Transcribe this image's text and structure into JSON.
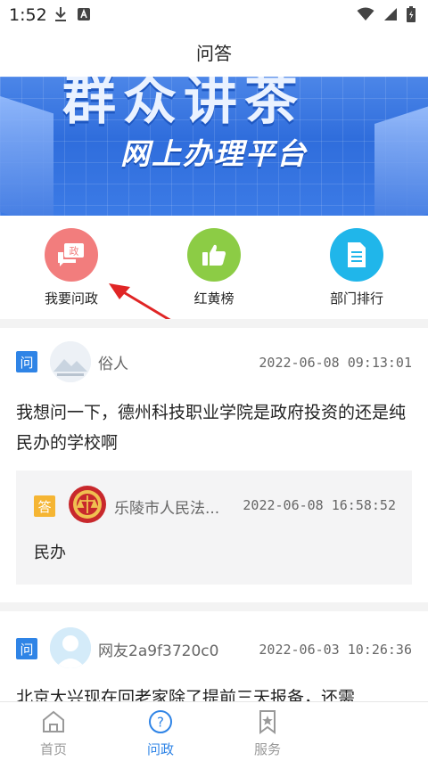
{
  "status": {
    "time": "1:52"
  },
  "nav": {
    "title": "问答"
  },
  "banner": {
    "title_partial": "群众讲茶",
    "subtitle": "网上办理平台"
  },
  "quick_actions": [
    {
      "label": "我要问政",
      "icon": "ask-government-icon",
      "color": "#f27d7d"
    },
    {
      "label": "红黄榜",
      "icon": "thumbs-up-icon",
      "color": "#8ccc45"
    },
    {
      "label": "部门排行",
      "icon": "document-icon",
      "color": "#20b6ea"
    }
  ],
  "posts": [
    {
      "badge": "问",
      "author": "俗人",
      "date": "2022-06-08 09:13:01",
      "question": "我想问一下，德州科技职业学院是政府投资的还是纯民办的学校啊",
      "answer": {
        "badge": "答",
        "author": "乐陵市人民法...",
        "date": "2022-06-08 16:58:52",
        "text": "民办"
      }
    },
    {
      "badge": "问",
      "author": "网友2a9f3720c0",
      "date": "2022-06-03 10:26:36",
      "question": "北京大兴现在回老家除了提前三天报备，还需"
    }
  ],
  "tabs": [
    {
      "label": "首页",
      "icon": "home-icon",
      "active": false
    },
    {
      "label": "问政",
      "icon": "question-icon",
      "active": true
    },
    {
      "label": "服务",
      "icon": "star-bookmark-icon",
      "active": false
    }
  ],
  "colors": {
    "accent": "#2f84e6",
    "inactive": "#999999",
    "answer_badge": "#f5b533"
  }
}
